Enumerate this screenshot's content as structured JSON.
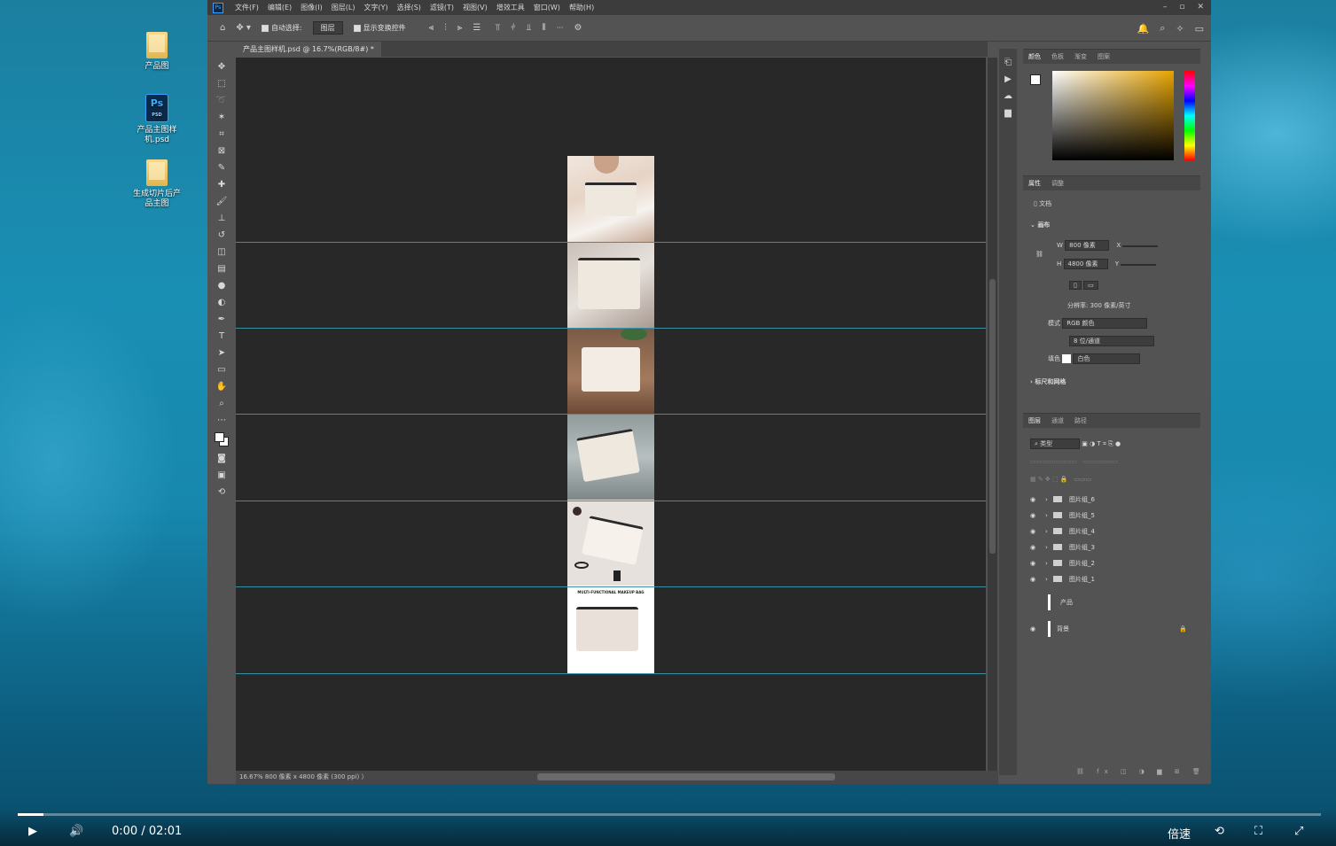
{
  "desktop": {
    "icons": [
      {
        "label": "产品图",
        "icon": "folder-icon"
      },
      {
        "label": "产品主图样机.psd",
        "icon": "photoshop-file-icon"
      },
      {
        "label": "生成切片后产品主图",
        "icon": "folder-icon"
      }
    ]
  },
  "photoshop": {
    "logo": "Ps",
    "menus": [
      "文件(F)",
      "编辑(E)",
      "图像(I)",
      "图层(L)",
      "文字(Y)",
      "选择(S)",
      "滤镜(T)",
      "视图(V)",
      "增效工具",
      "窗口(W)",
      "帮助(H)"
    ],
    "options": {
      "auto_select_label": "自动选择:",
      "auto_select_value": "图层",
      "show_transform_label": "显示变换控件",
      "more": "···"
    },
    "doc_tab": "产品主图样机.psd @ 16.7%(RGB/8#) *",
    "status": "16.67%   800 像素 x 4800 像素 (300 ppi)   〉",
    "color_panel_tabs": [
      "颜色",
      "色板",
      "渐变",
      "图案"
    ],
    "properties": {
      "tabs": [
        "属性",
        "调整"
      ],
      "doc_label": "文档",
      "canvas_header": "画布",
      "w_label": "W",
      "w_value": "800 像素",
      "h_label": "H",
      "h_value": "4800 像素",
      "x_label": "X",
      "y_label": "Y",
      "resolution": "分辨率: 300 像素/英寸",
      "mode_label": "模式",
      "mode_value": "RGB 颜色",
      "depth_value": "8 位/通道",
      "fill_label": "填色",
      "fill_value": "白色",
      "rulers_header": "标尺和网格"
    },
    "layers": {
      "tabs": [
        "图层",
        "通道",
        "路径"
      ],
      "filter_kind": "类型",
      "items": [
        {
          "name": "图片组_6",
          "type": "group"
        },
        {
          "name": "图片组_5",
          "type": "group"
        },
        {
          "name": "图片组_4",
          "type": "group"
        },
        {
          "name": "图片组_3",
          "type": "group"
        },
        {
          "name": "图片组_2",
          "type": "group"
        },
        {
          "name": "图片组_1",
          "type": "group"
        },
        {
          "name": "产品",
          "type": "layer"
        },
        {
          "name": "背景",
          "type": "background"
        }
      ]
    },
    "canvas_tiles": [
      {
        "scene": "woman-holding-pouch"
      },
      {
        "scene": "hands-opening-pouch"
      },
      {
        "scene": "pouch-on-table"
      },
      {
        "scene": "pouch-held-grey-shirt"
      },
      {
        "scene": "pouch-with-cosmetics"
      },
      {
        "scene": "product-dimension-card",
        "title": "MULTI-FUNCTIONAL MAKEUP BAG"
      }
    ]
  },
  "video": {
    "time": "0:00 / 02:01",
    "speed_label": "倍速",
    "progress": 0.02
  },
  "colors": {
    "ps_bg": "#535353",
    "canvas_bg": "#282828",
    "guide": "#3a8fa3"
  }
}
